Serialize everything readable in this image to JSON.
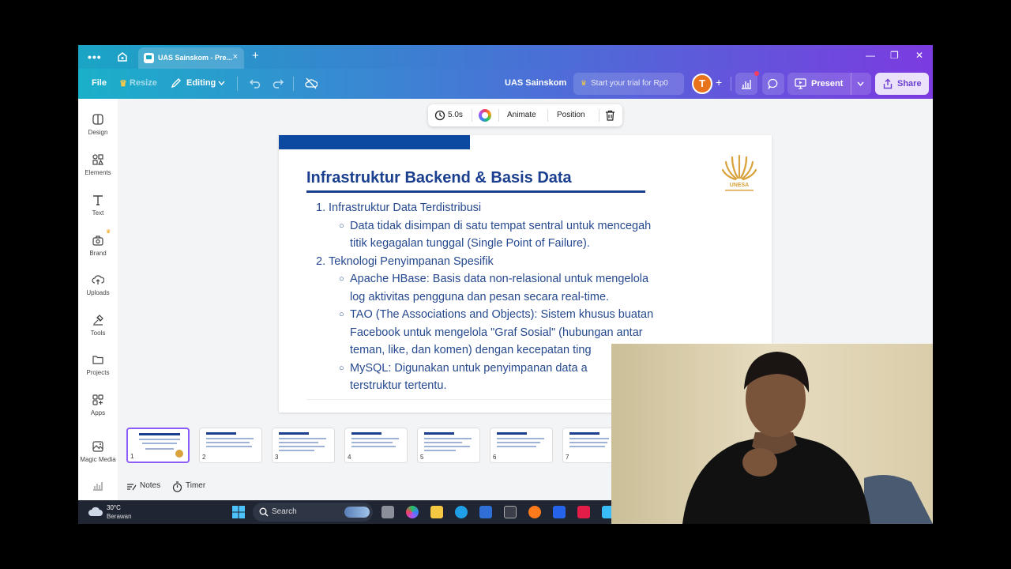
{
  "browser": {
    "tab_title": "UAS Sainskom - Pre...",
    "tab_close": "×",
    "new_tab": "+",
    "more": "•••",
    "window": {
      "minimize": "—",
      "restore": "❐",
      "close": "✕"
    }
  },
  "toolbar": {
    "file": "File",
    "resize": "Resize",
    "editing": "Editing",
    "doc_title": "UAS Sainskom",
    "trial": "Start your trial for Rp0",
    "avatar_initial": "T",
    "present": "Present",
    "share": "Share"
  },
  "sidebar": {
    "items": [
      {
        "label": "Design"
      },
      {
        "label": "Elements"
      },
      {
        "label": "Text"
      },
      {
        "label": "Brand"
      },
      {
        "label": "Uploads"
      },
      {
        "label": "Tools"
      },
      {
        "label": "Projects"
      },
      {
        "label": "Apps"
      },
      {
        "label": "Magic Media"
      }
    ]
  },
  "context_toolbar": {
    "duration": "5.0s",
    "animate": "Animate",
    "position": "Position"
  },
  "slide": {
    "title": "Infrastruktur Backend & Basis Data",
    "logo_text": "UNESA",
    "items": [
      {
        "num": "1.",
        "text": "Infrastruktur Data Terdistribusi"
      },
      {
        "bullet": "○",
        "lines": [
          "Data tidak disimpan di satu tempat sentral untuk mencegah",
          "titik kegagalan tunggal (Single Point of Failure)."
        ]
      },
      {
        "num": "2.",
        "text": "Teknologi Penyimpanan Spesifik"
      },
      {
        "bullet": "○",
        "lines": [
          "Apache HBase: Basis data non-relasional untuk mengelola",
          "log aktivitas pengguna dan pesan secara real-time."
        ]
      },
      {
        "bullet": "○",
        "lines": [
          "TAO (The Associations and Objects): Sistem khusus buatan",
          "Facebook untuk mengelola \"Graf Sosial\" (hubungan antar",
          "teman, like, dan komen) dengan kecepatan ting"
        ]
      },
      {
        "bullet": "○",
        "lines": [
          "MySQL: Digunakan untuk penyimpanan data a",
          "terstruktur tertentu."
        ]
      }
    ]
  },
  "thumbnails": [
    "1",
    "2",
    "3",
    "4",
    "5",
    "6",
    "7"
  ],
  "bottom_bar": {
    "notes": "Notes",
    "timer": "Timer"
  },
  "taskbar": {
    "temperature": "30°C",
    "condition": "Berawan",
    "search": "Search"
  },
  "colors": {
    "slide_title": "#1b3f8f",
    "slide_text": "#26498f",
    "slide_bar": "#0b4aa0",
    "toolbar_gradient_start": "#1ab0c9",
    "toolbar_gradient_end": "#7c3ae0",
    "avatar": "#e8731a"
  }
}
